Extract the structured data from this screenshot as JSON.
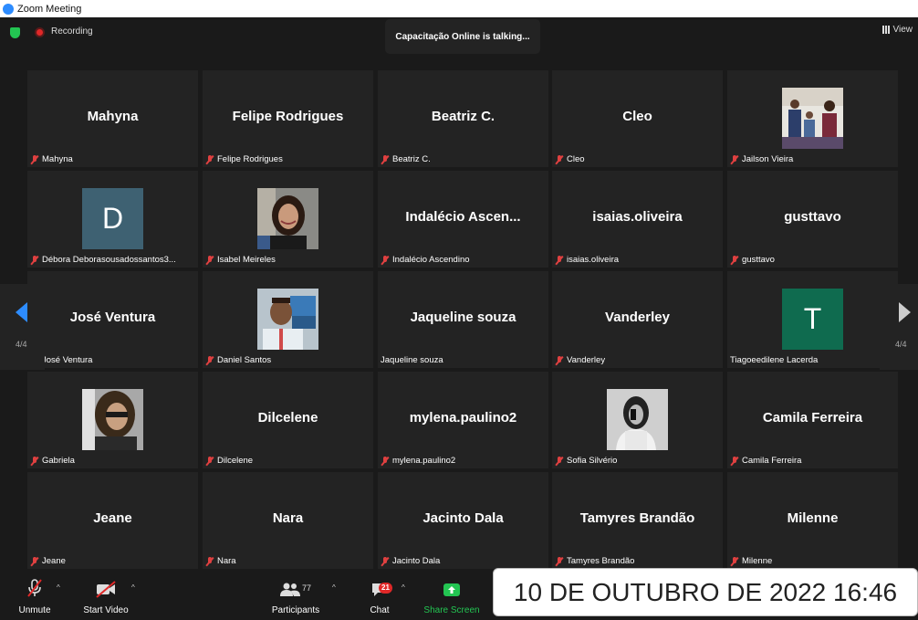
{
  "window": {
    "title": "Zoom Meeting"
  },
  "topbar": {
    "recording_label": "Recording",
    "talking": "Capacitação Online is talking...",
    "view_label": "View"
  },
  "tiles": [
    {
      "display": "Mahyna",
      "label": "Mahyna",
      "muted": true,
      "kind": "name"
    },
    {
      "display": "Felipe Rodrigues",
      "label": "Felipe Rodrigues",
      "muted": true,
      "kind": "name"
    },
    {
      "display": "Beatriz C.",
      "label": "Beatriz C.",
      "muted": true,
      "kind": "name"
    },
    {
      "display": "Cleo",
      "label": "Cleo",
      "muted": true,
      "kind": "name"
    },
    {
      "display": "",
      "label": "Jailson Vieira",
      "muted": true,
      "kind": "photo",
      "photo": "family"
    },
    {
      "display": "D",
      "label": "Débora Deborasousadossantos3...",
      "muted": true,
      "kind": "letter",
      "color": "#3e6172"
    },
    {
      "display": "",
      "label": "Isabel Meireles",
      "muted": true,
      "kind": "photo",
      "photo": "woman"
    },
    {
      "display": "Indalécio  Ascen...",
      "label": "Indalécio Ascendino",
      "muted": true,
      "kind": "name"
    },
    {
      "display": "isaias.oliveira",
      "label": "isaias.oliveira",
      "muted": true,
      "kind": "name"
    },
    {
      "display": "gusttavo",
      "label": "gusttavo",
      "muted": true,
      "kind": "name"
    },
    {
      "display": "José Ventura",
      "label": "José Ventura",
      "muted": true,
      "kind": "name"
    },
    {
      "display": "",
      "label": "Daniel Santos",
      "muted": true,
      "kind": "photo",
      "photo": "man"
    },
    {
      "display": "Jaqueline souza",
      "label": "Jaqueline souza",
      "muted": false,
      "kind": "name"
    },
    {
      "display": "Vanderley",
      "label": "Vanderley",
      "muted": true,
      "kind": "name"
    },
    {
      "display": "T",
      "label": "Tiagoeedilene Lacerda",
      "muted": false,
      "kind": "letter",
      "color": "#0f6b4f"
    },
    {
      "display": "",
      "label": "Gabriela",
      "muted": true,
      "kind": "photo",
      "photo": "girl"
    },
    {
      "display": "Dilcelene",
      "label": "Dilcelene",
      "muted": true,
      "kind": "name"
    },
    {
      "display": "mylena.paulino2",
      "label": "mylena.paulino2",
      "muted": true,
      "kind": "name"
    },
    {
      "display": "",
      "label": "Sofia Silvério",
      "muted": true,
      "kind": "photo",
      "photo": "bw"
    },
    {
      "display": "Camila Ferreira",
      "label": "Camila Ferreira",
      "muted": true,
      "kind": "name"
    },
    {
      "display": "Jeane",
      "label": "Jeane",
      "muted": true,
      "kind": "name"
    },
    {
      "display": "Nara",
      "label": "Nara",
      "muted": true,
      "kind": "name"
    },
    {
      "display": "Jacinto Dala",
      "label": "Jacinto Dala",
      "muted": true,
      "kind": "name"
    },
    {
      "display": "Tamyres Brandão",
      "label": "Tamyres Brandão",
      "muted": true,
      "kind": "name"
    },
    {
      "display": "Milenne",
      "label": "Milenne",
      "muted": true,
      "kind": "name"
    }
  ],
  "pagination": {
    "left": "4/4",
    "right": "4/4"
  },
  "toolbar": {
    "unmute": "Unmute",
    "start_video": "Start Video",
    "participants": "Participants",
    "participants_count": "77",
    "chat": "Chat",
    "chat_badge": "21",
    "share_screen": "Share Screen"
  },
  "timestamp": "10 DE OUTUBRO DE 2022 16:46",
  "colors": {
    "accent": "#2d8cff",
    "share": "#23c552",
    "muted": "#e04040",
    "tile_bg": "#232323"
  }
}
